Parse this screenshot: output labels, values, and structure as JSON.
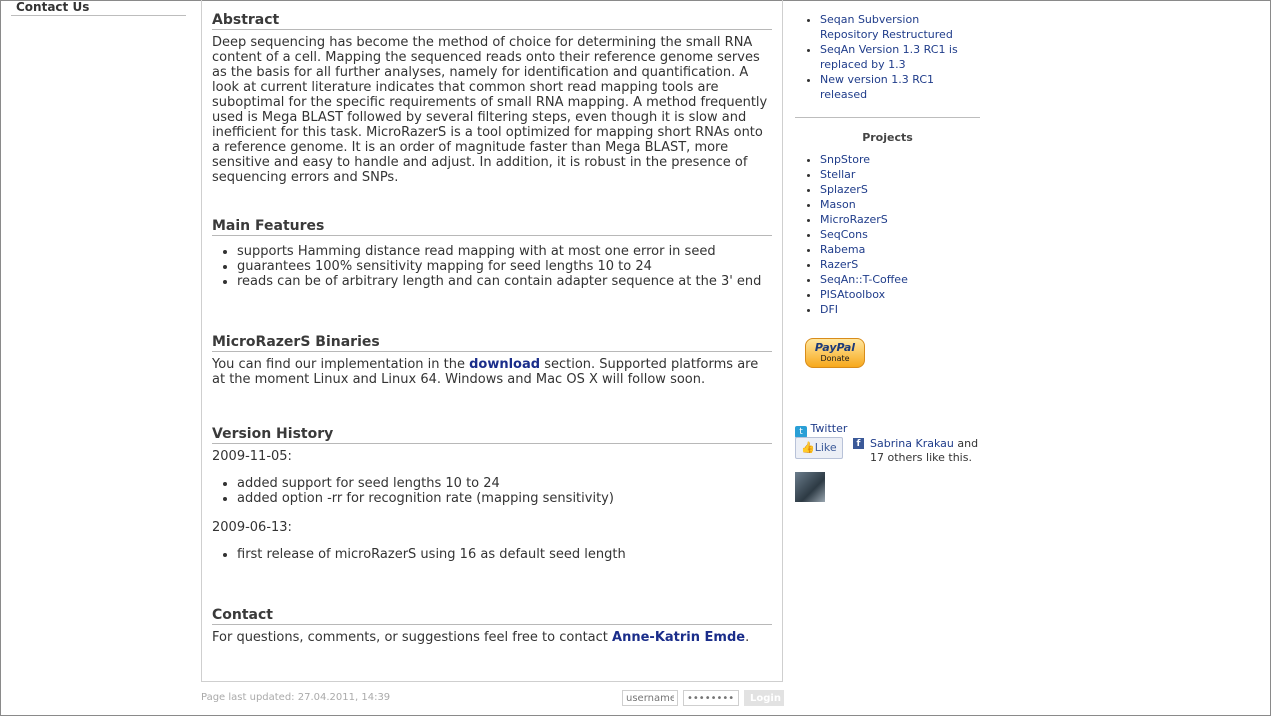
{
  "left_nav": {
    "contact_us": "Contact Us"
  },
  "abstract": {
    "title": "Abstract",
    "text": "Deep sequencing has become the method of choice for determining the small RNA content of a cell. Mapping the sequenced reads onto their reference genome serves as the basis for all further analyses, namely for identification and quantification. A look at current literature indicates that common short read mapping tools are suboptimal for the specific requirements of small RNA mapping. A method frequently used is Mega BLAST followed by several filtering steps, even though it is slow and inefficient for this task. MicroRazerS is a tool optimized for mapping short RNAs onto a reference genome. It is an order of magnitude faster than Mega BLAST, more sensitive and easy to handle and adjust. In addition, it is robust in the presence of sequencing errors and SNPs."
  },
  "features": {
    "title": "Main Features",
    "items": [
      "supports Hamming distance read mapping with at most one error in seed",
      "guarantees 100% sensitivity mapping for seed lengths 10 to 24",
      "reads can be of arbitrary length and can contain adapter sequence at the 3' end"
    ]
  },
  "binaries": {
    "title": "MicroRazerS Binaries",
    "text_before": "You can find our implementation in the ",
    "link": "download",
    "text_after": " section. Supported platforms are at the moment Linux and Linux 64. Windows and Mac OS X will follow soon."
  },
  "history": {
    "title": "Version History",
    "date1": "2009-11-05:",
    "items1": [
      "added support for seed lengths 10 to 24",
      "added option -rr for recognition rate (mapping sensitivity)"
    ],
    "date2": "2009-06-13:",
    "items2": [
      "first release of microRazerS using 16 as default seed length"
    ]
  },
  "contact": {
    "title": "Contact",
    "text_before": "For questions, comments, or suggestions feel free to contact ",
    "link": "Anne-Katrin Emde",
    "text_after": "."
  },
  "footer": {
    "updated": "Page last updated: 27.04.2011, 14:39",
    "username_placeholder": "username",
    "password_placeholder": "••••••••",
    "login": "Login"
  },
  "sidebar": {
    "news": [
      "Seqan Subversion Repository Restructured",
      "SeqAn Version 1.3 RC1 is replaced by 1.3",
      "New version 1.3 RC1 released"
    ],
    "projects_title": "Projects",
    "projects": [
      "SnpStore",
      "Stellar",
      "SplazerS",
      "Mason",
      "MicroRazerS",
      "SeqCons",
      "Rabema",
      "RazerS",
      "SeqAn::T-Coffee",
      "PISAtoolbox",
      "DFI"
    ],
    "paypal_main": "PayPal",
    "paypal_sub": "Donate",
    "twitter": "Twitter",
    "like": "Like",
    "like_person": "Sabrina Krakau",
    "like_rest": " and 17 others like this."
  }
}
